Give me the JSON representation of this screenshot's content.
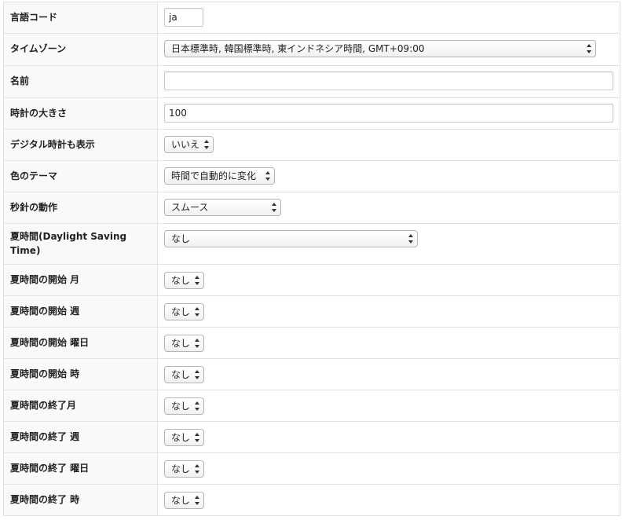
{
  "rows": [
    {
      "label": "言語コード",
      "value": "ja"
    },
    {
      "label": "タイムゾーン",
      "value": "日本標準時, 韓国標準時, 東インドネシア時間, GMT+09:00"
    },
    {
      "label": "名前",
      "value": ""
    },
    {
      "label": "時計の大きさ",
      "value": "100"
    },
    {
      "label": "デジタル時計も表示",
      "value": "いいえ"
    },
    {
      "label": "色のテーマ",
      "value": "時間で自動的に変化"
    },
    {
      "label": "秒針の動作",
      "value": "スムース"
    },
    {
      "label": "夏時間(Daylight Saving Time)",
      "value": "なし"
    },
    {
      "label": "夏時間の開始 月",
      "value": "なし"
    },
    {
      "label": "夏時間の開始 週",
      "value": "なし"
    },
    {
      "label": "夏時間の開始 曜日",
      "value": "なし"
    },
    {
      "label": "夏時間の開始 時",
      "value": "なし"
    },
    {
      "label": "夏時間の終了月",
      "value": "なし"
    },
    {
      "label": "夏時間の終了 週",
      "value": "なし"
    },
    {
      "label": "夏時間の終了 曜日",
      "value": "なし"
    },
    {
      "label": "夏時間の終了 時",
      "value": "なし"
    }
  ],
  "icons": {
    "select_arrows": "updown-chevron-icon"
  }
}
